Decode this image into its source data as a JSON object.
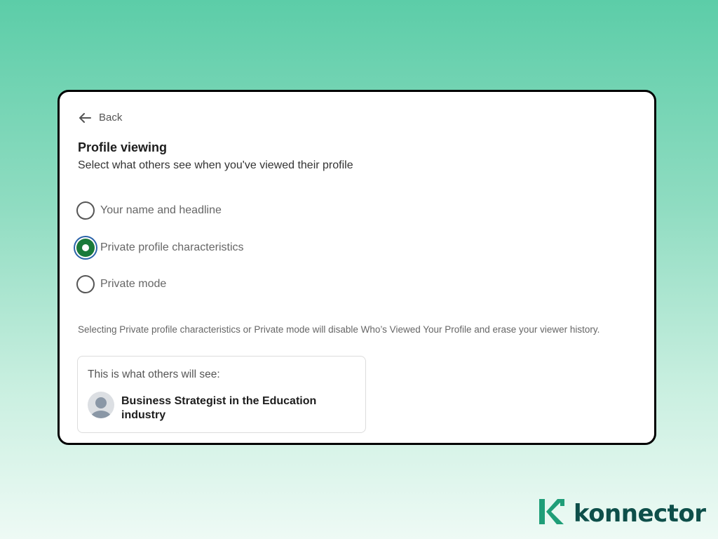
{
  "nav": {
    "back_label": "Back"
  },
  "section": {
    "title": "Profile viewing",
    "subtitle": "Select what others see when you've viewed their profile"
  },
  "options": [
    {
      "label": "Your name and headline",
      "selected": false
    },
    {
      "label": "Private profile characteristics",
      "selected": true
    },
    {
      "label": "Private mode",
      "selected": false
    }
  ],
  "note": "Selecting Private profile characteristics or Private mode will disable Who’s Viewed Your Profile and erase your viewer history.",
  "preview": {
    "label": "This is what others will see:",
    "headline": "Business Strategist in the Education industry"
  },
  "brand": {
    "name": "konnector",
    "accent_color": "#1f9e78",
    "text_color": "#0e4f4a",
    "selected_radio_color": "#1a7a3a",
    "focus_ring_color": "#2a63a8"
  }
}
